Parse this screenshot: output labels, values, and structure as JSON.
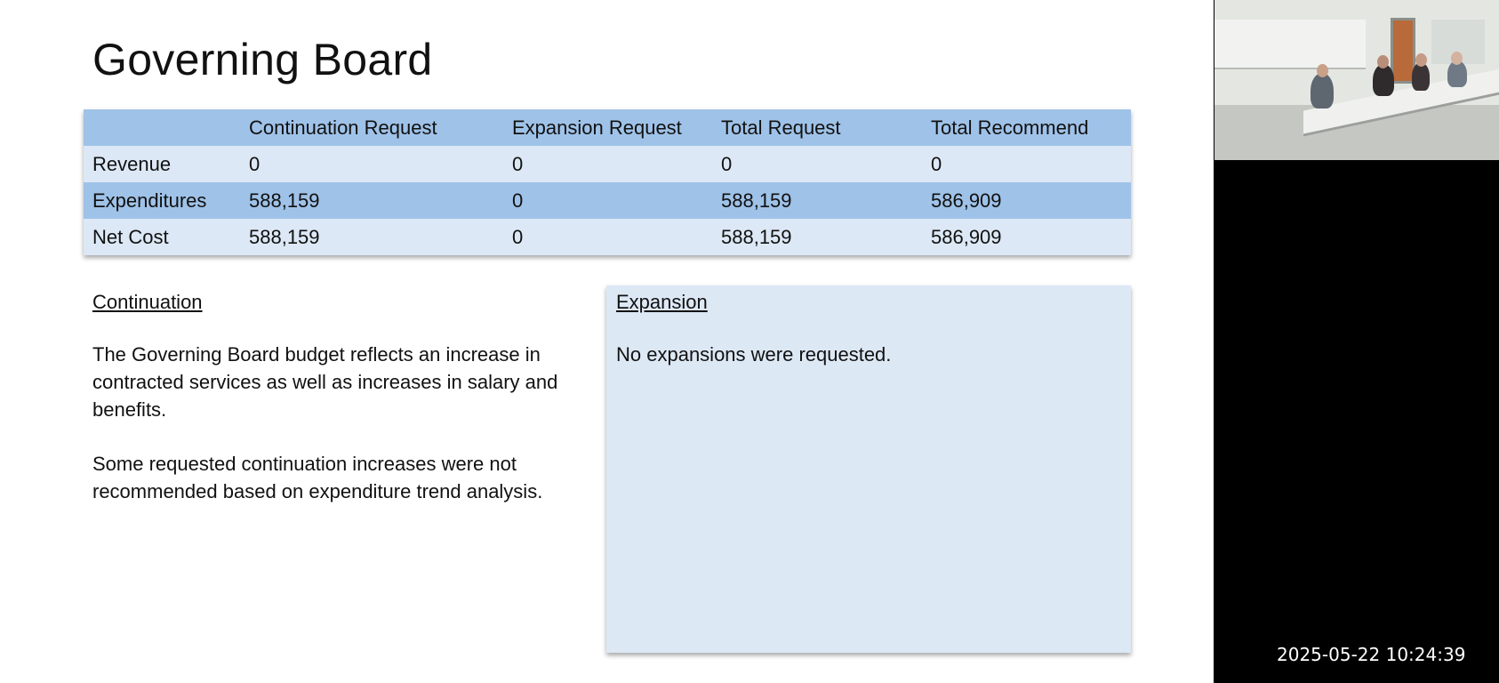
{
  "slide": {
    "title": "Governing Board",
    "table": {
      "headers": [
        "",
        "Continuation Request",
        "Expansion Request",
        "Total Request",
        "Total Recommend"
      ],
      "rows": [
        [
          "Revenue",
          "0",
          "0",
          "0",
          "0"
        ],
        [
          "Expenditures",
          "588,159",
          "0",
          "588,159",
          "586,909"
        ],
        [
          "Net Cost",
          "588,159",
          "0",
          "588,159",
          "586,909"
        ]
      ]
    },
    "continuation": {
      "heading": "Continuation",
      "paragraphs": [
        "The Governing Board budget reflects an increase in contracted services as well as increases in salary and benefits.",
        "Some requested continuation increases were not recommended based on expenditure trend analysis."
      ]
    },
    "expansion": {
      "heading": "Expansion",
      "text": "No expansions were requested."
    }
  },
  "video": {
    "timestamp": "2025-05-22 10:24:39"
  },
  "colors": {
    "table_header": "#9fc2e8",
    "table_row_light": "#dce8f5",
    "table_row_dark": "#9fc2e8",
    "expansion_box": "#dde8f5"
  }
}
